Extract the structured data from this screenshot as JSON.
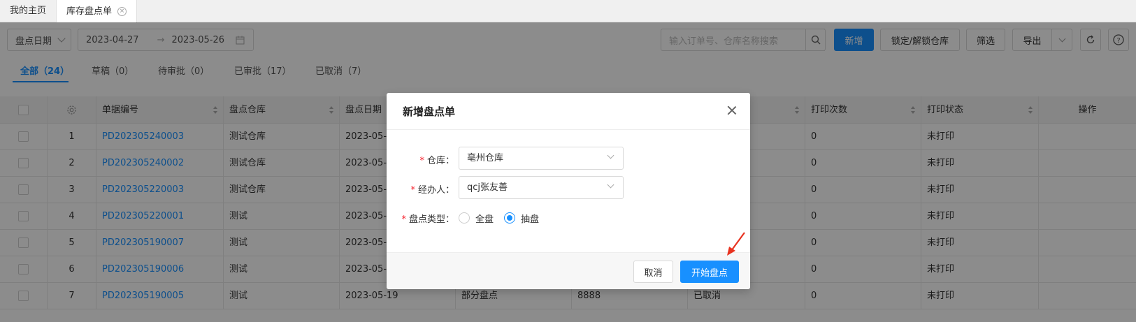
{
  "tabs": [
    {
      "label": "我的主页"
    },
    {
      "label": "库存盘点单"
    }
  ],
  "toolbar": {
    "date_type": "盘点日期",
    "date_start": "2023-04-27",
    "date_sep": "→",
    "date_end": "2023-05-26",
    "search_placeholder": "输入订单号、仓库名称搜索",
    "new_label": "新增",
    "lock_label": "锁定/解锁仓库",
    "filter_label": "筛选",
    "export_label": "导出"
  },
  "status_tabs": [
    {
      "label": "全部（24）"
    },
    {
      "label": "草稿（0）"
    },
    {
      "label": "待审批（0）"
    },
    {
      "label": "已审批（17）"
    },
    {
      "label": "已取消（7）"
    }
  ],
  "table": {
    "headers": {
      "no": "单据编号",
      "warehouse": "盘点仓库",
      "date": "盘点日期",
      "print_count": "打印次数",
      "print_status": "打印状态",
      "action": "操作"
    },
    "rows": [
      {
        "idx": "1",
        "no": "PD202305240003",
        "warehouse": "测试仓库",
        "date": "2023-05-",
        "type": "",
        "amount": "",
        "status": "",
        "print_count": "0",
        "print_status": "未打印"
      },
      {
        "idx": "2",
        "no": "PD202305240002",
        "warehouse": "测试仓库",
        "date": "2023-05-",
        "type": "",
        "amount": "",
        "status": "",
        "print_count": "0",
        "print_status": "未打印"
      },
      {
        "idx": "3",
        "no": "PD202305220003",
        "warehouse": "测试仓库",
        "date": "2023-05-",
        "type": "",
        "amount": "",
        "status": "",
        "print_count": "0",
        "print_status": "未打印"
      },
      {
        "idx": "4",
        "no": "PD202305220001",
        "warehouse": "测试",
        "date": "2023-05-",
        "type": "",
        "amount": "",
        "status": "",
        "print_count": "0",
        "print_status": "未打印"
      },
      {
        "idx": "5",
        "no": "PD202305190007",
        "warehouse": "测试",
        "date": "2023-05-",
        "type": "",
        "amount": "",
        "status": "",
        "print_count": "0",
        "print_status": "未打印"
      },
      {
        "idx": "6",
        "no": "PD202305190006",
        "warehouse": "测试",
        "date": "2023-05-",
        "type": "",
        "amount": "",
        "status": "",
        "print_count": "0",
        "print_status": "未打印"
      },
      {
        "idx": "7",
        "no": "PD202305190005",
        "warehouse": "测试",
        "date": "2023-05-19",
        "type": "部分盘点",
        "amount": "8888",
        "status": "已取消",
        "print_count": "0",
        "print_status": "未打印"
      }
    ]
  },
  "modal": {
    "title": "新增盘点单",
    "warehouse_label": "仓库：",
    "warehouse_value": "亳州仓库",
    "handler_label": "经办人：",
    "handler_value": "qcj张友善",
    "type_label": "盘点类型：",
    "type_options": [
      "全盘",
      "抽盘"
    ],
    "type_selected": "抽盘",
    "cancel_label": "取消",
    "start_label": "开始盘点"
  },
  "colors": {
    "primary": "#1890ff",
    "required": "#f5222d",
    "annotation_arrow": "#e8321f"
  }
}
